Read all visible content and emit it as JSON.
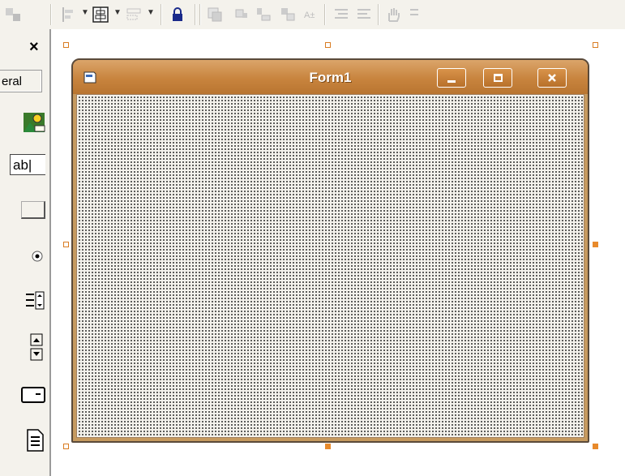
{
  "toolbox": {
    "close_label": "×",
    "tab_label": "eral",
    "textbox_label": "ab|"
  },
  "form": {
    "title": "Form1"
  },
  "colors": {
    "titlebar": "#c8843e",
    "handle": "#e88a2b",
    "client_bg": "#f4f2ec"
  },
  "icons": {
    "toolbar": [
      "align-left-icon",
      "center-form-icon",
      "make-same-size-icon",
      "lock-controls-icon",
      "bring-to-front-icon",
      "send-to-back-icon",
      "tab-order-icon",
      "hand-icon"
    ],
    "toolbox": [
      "picture-icon",
      "textbox-icon",
      "command-button-icon",
      "option-button-icon",
      "listbox-icon",
      "vscroll-icon",
      "frame-icon",
      "data-icon"
    ]
  }
}
